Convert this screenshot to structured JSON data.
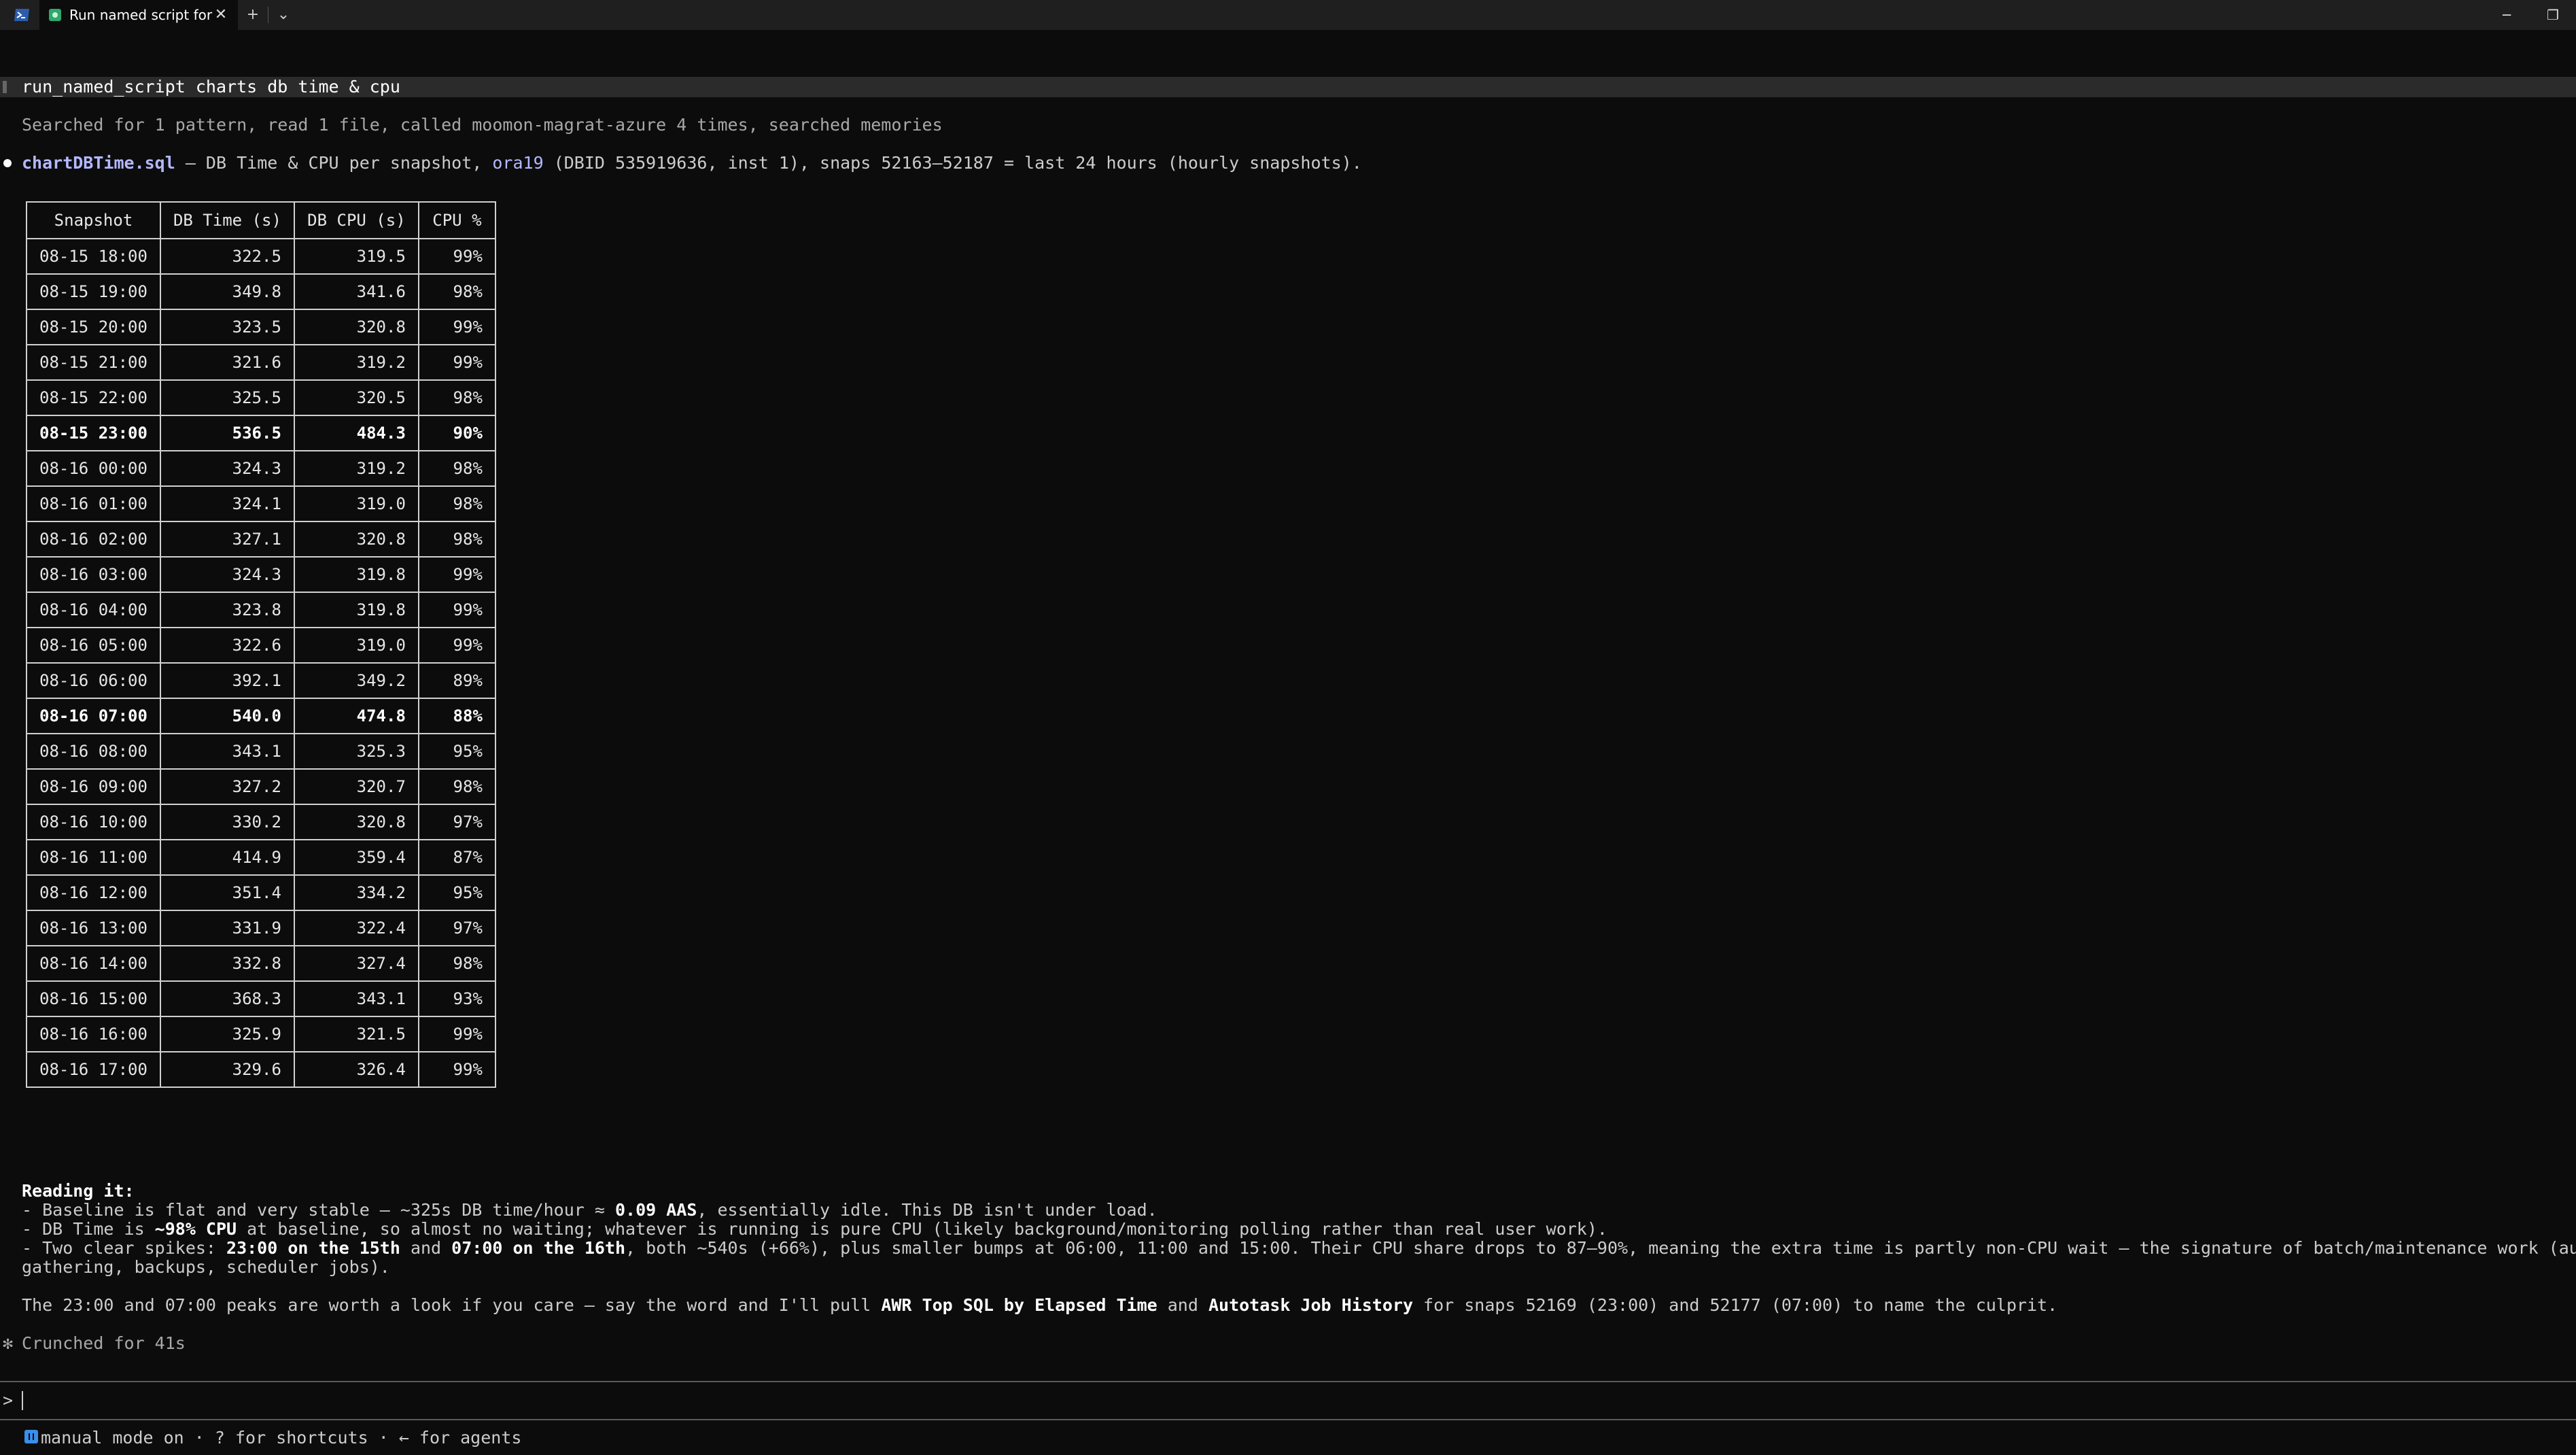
{
  "window": {
    "tab_title": "Run named script for char",
    "tab_close": "✕",
    "new_tab": "+",
    "dropdown": "⌄",
    "minimize": "─",
    "restore": "❐"
  },
  "command": "run_named_script charts db time & cpu",
  "activity": "Searched for 1 pattern, read 1 file, called moomon-magrat-azure 4 times, searched memories",
  "summary": {
    "file": "chartDBTime.sql",
    "text1": " – DB Time & CPU per snapshot, ",
    "db": "ora19",
    "text2": " (DBID 535919636, inst 1), snaps 52163–52187 = last 24 hours (hourly snapshots)."
  },
  "table": {
    "headers": [
      "Snapshot",
      "DB Time (s)",
      "DB CPU (s)",
      "CPU %"
    ],
    "rows": [
      {
        "snapshot": "08-15 18:00",
        "db_time": "322.5",
        "db_cpu": "319.5",
        "cpu_pct": "99%",
        "bold": false
      },
      {
        "snapshot": "08-15 19:00",
        "db_time": "349.8",
        "db_cpu": "341.6",
        "cpu_pct": "98%",
        "bold": false
      },
      {
        "snapshot": "08-15 20:00",
        "db_time": "323.5",
        "db_cpu": "320.8",
        "cpu_pct": "99%",
        "bold": false
      },
      {
        "snapshot": "08-15 21:00",
        "db_time": "321.6",
        "db_cpu": "319.2",
        "cpu_pct": "99%",
        "bold": false
      },
      {
        "snapshot": "08-15 22:00",
        "db_time": "325.5",
        "db_cpu": "320.5",
        "cpu_pct": "98%",
        "bold": false
      },
      {
        "snapshot": "08-15 23:00",
        "db_time": "536.5",
        "db_cpu": "484.3",
        "cpu_pct": "90%",
        "bold": true
      },
      {
        "snapshot": "08-16 00:00",
        "db_time": "324.3",
        "db_cpu": "319.2",
        "cpu_pct": "98%",
        "bold": false
      },
      {
        "snapshot": "08-16 01:00",
        "db_time": "324.1",
        "db_cpu": "319.0",
        "cpu_pct": "98%",
        "bold": false
      },
      {
        "snapshot": "08-16 02:00",
        "db_time": "327.1",
        "db_cpu": "320.8",
        "cpu_pct": "98%",
        "bold": false
      },
      {
        "snapshot": "08-16 03:00",
        "db_time": "324.3",
        "db_cpu": "319.8",
        "cpu_pct": "99%",
        "bold": false
      },
      {
        "snapshot": "08-16 04:00",
        "db_time": "323.8",
        "db_cpu": "319.8",
        "cpu_pct": "99%",
        "bold": false
      },
      {
        "snapshot": "08-16 05:00",
        "db_time": "322.6",
        "db_cpu": "319.0",
        "cpu_pct": "99%",
        "bold": false
      },
      {
        "snapshot": "08-16 06:00",
        "db_time": "392.1",
        "db_cpu": "349.2",
        "cpu_pct": "89%",
        "bold": false
      },
      {
        "snapshot": "08-16 07:00",
        "db_time": "540.0",
        "db_cpu": "474.8",
        "cpu_pct": "88%",
        "bold": true
      },
      {
        "snapshot": "08-16 08:00",
        "db_time": "343.1",
        "db_cpu": "325.3",
        "cpu_pct": "95%",
        "bold": false
      },
      {
        "snapshot": "08-16 09:00",
        "db_time": "327.2",
        "db_cpu": "320.7",
        "cpu_pct": "98%",
        "bold": false
      },
      {
        "snapshot": "08-16 10:00",
        "db_time": "330.2",
        "db_cpu": "320.8",
        "cpu_pct": "97%",
        "bold": false
      },
      {
        "snapshot": "08-16 11:00",
        "db_time": "414.9",
        "db_cpu": "359.4",
        "cpu_pct": "87%",
        "bold": false
      },
      {
        "snapshot": "08-16 12:00",
        "db_time": "351.4",
        "db_cpu": "334.2",
        "cpu_pct": "95%",
        "bold": false
      },
      {
        "snapshot": "08-16 13:00",
        "db_time": "331.9",
        "db_cpu": "322.4",
        "cpu_pct": "97%",
        "bold": false
      },
      {
        "snapshot": "08-16 14:00",
        "db_time": "332.8",
        "db_cpu": "327.4",
        "cpu_pct": "98%",
        "bold": false
      },
      {
        "snapshot": "08-16 15:00",
        "db_time": "368.3",
        "db_cpu": "343.1",
        "cpu_pct": "93%",
        "bold": false
      },
      {
        "snapshot": "08-16 16:00",
        "db_time": "325.9",
        "db_cpu": "321.5",
        "cpu_pct": "99%",
        "bold": false
      },
      {
        "snapshot": "08-16 17:00",
        "db_time": "329.6",
        "db_cpu": "326.4",
        "cpu_pct": "99%",
        "bold": false
      }
    ]
  },
  "reading": {
    "heading": "Reading it:",
    "l1a": "- Baseline is flat and very stable – ~325s DB time/hour ≈ ",
    "l1b": "0.09 AAS",
    "l1c": ", essentially idle. This DB isn't under load.",
    "l2a": "- DB Time is ",
    "l2b": "~98% CPU",
    "l2c": " at baseline, so almost no waiting; whatever is running is pure CPU (likely background/monitoring polling rather than real user work).",
    "l3a": "- Two clear spikes: ",
    "l3b": "23:00 on the 15th",
    "l3c": " and ",
    "l3d": "07:00 on the 16th",
    "l3e": ", both ~540s (+66%), plus smaller bumps at 06:00, 11:00 and 15:00. Their CPU share drops to 87–90%, meaning the extra time is partly non-CPU wait – the signature of batch/maintenance work (autotask stats",
    "l4": "gathering, backups, scheduler jobs)."
  },
  "followup": {
    "a": "The 23:00 and 07:00 peaks are worth a look if you care – say the word and I'll pull ",
    "b": "AWR Top SQL by Elapsed Time",
    "c": " and ",
    "d": "Autotask Job History",
    "e": " for snaps 52169 (23:00) and 52177 (07:00) to name the culprit."
  },
  "crunched": "Crunched for 41s",
  "crunch_glyph": "✻",
  "prompt": {
    "arrow": ">",
    "value": ""
  },
  "footer": "manual mode on · ? for shortcuts · ← for agents"
}
